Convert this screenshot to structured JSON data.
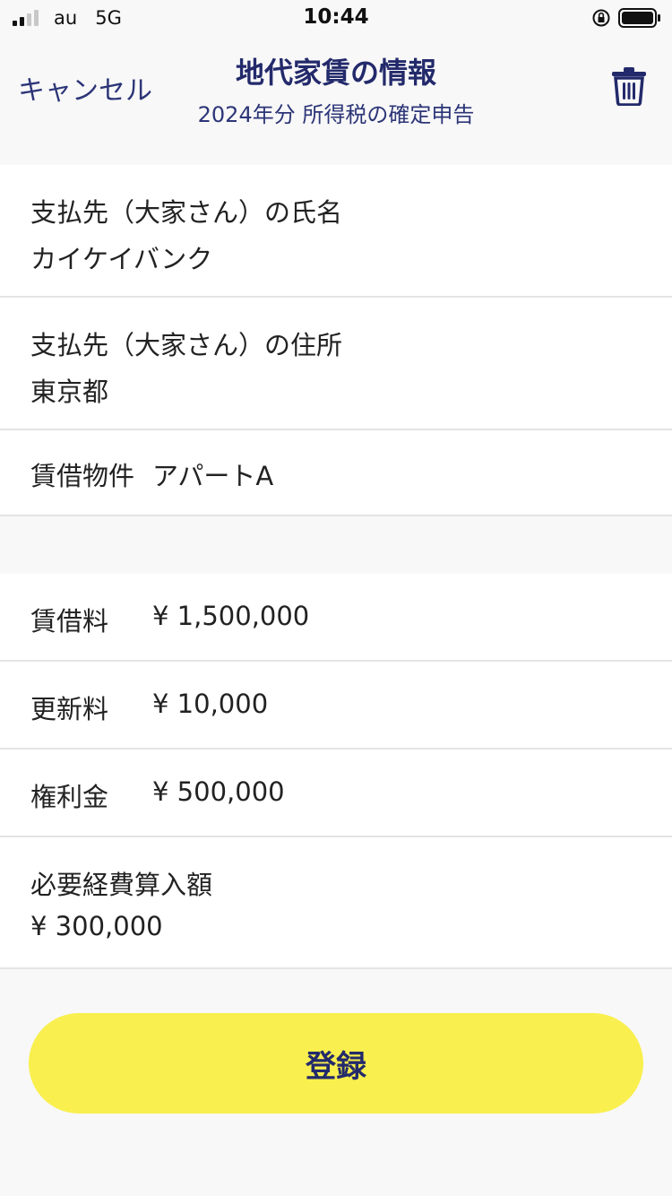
{
  "status": {
    "carrier": "au",
    "network": "5G",
    "time": "10:44",
    "signal_bars": 4,
    "signal_filled": 2
  },
  "nav": {
    "cancel_label": "キャンセル",
    "title": "地代家賃の情報",
    "subtitle": "2024年分 所得税の確定申告"
  },
  "landlord": {
    "name_label": "支払先（大家さん）の氏名",
    "name_value": "カイケイバンク",
    "address_label": "支払先（大家さん）の住所",
    "address_value": "東京都",
    "property_label": "賃借物件",
    "property_value": "アパートA"
  },
  "amounts": {
    "rent_label": "賃借料",
    "rent_value": "¥ 1,500,000",
    "renewal_label": "更新料",
    "renewal_value": "¥ 10,000",
    "key_money_label": "権利金",
    "key_money_value": "¥ 500,000",
    "expense_label": "必要経費算入額",
    "expense_value": "¥ 300,000"
  },
  "footer": {
    "register_label": "登録"
  },
  "colors": {
    "accent": "#232a6b",
    "button": "#f9ef4e",
    "background": "#f8f8f8"
  },
  "icons": {
    "trash": "trash-icon",
    "lock": "rotation-lock-icon",
    "battery": "battery-icon"
  }
}
